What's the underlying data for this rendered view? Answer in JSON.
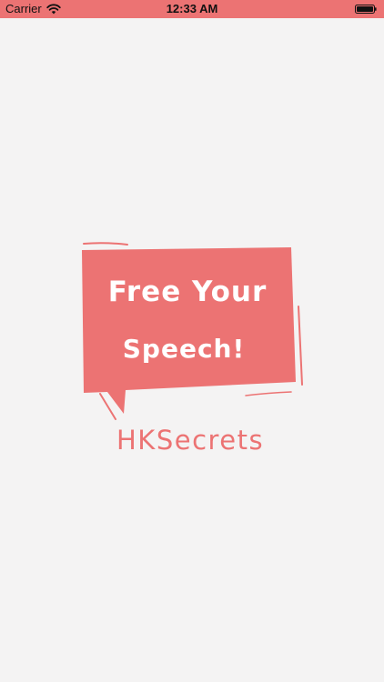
{
  "status_bar": {
    "carrier": "Carrier",
    "time": "12:33 AM",
    "signal_icon": "wifi-icon",
    "battery_icon": "battery-icon"
  },
  "splash": {
    "bubble_text_line1": "Free Your",
    "bubble_text_line2": "Speech!",
    "app_name": "HKSecrets",
    "accent_color": "#ec7373",
    "background_color": "#f4f3f3"
  }
}
